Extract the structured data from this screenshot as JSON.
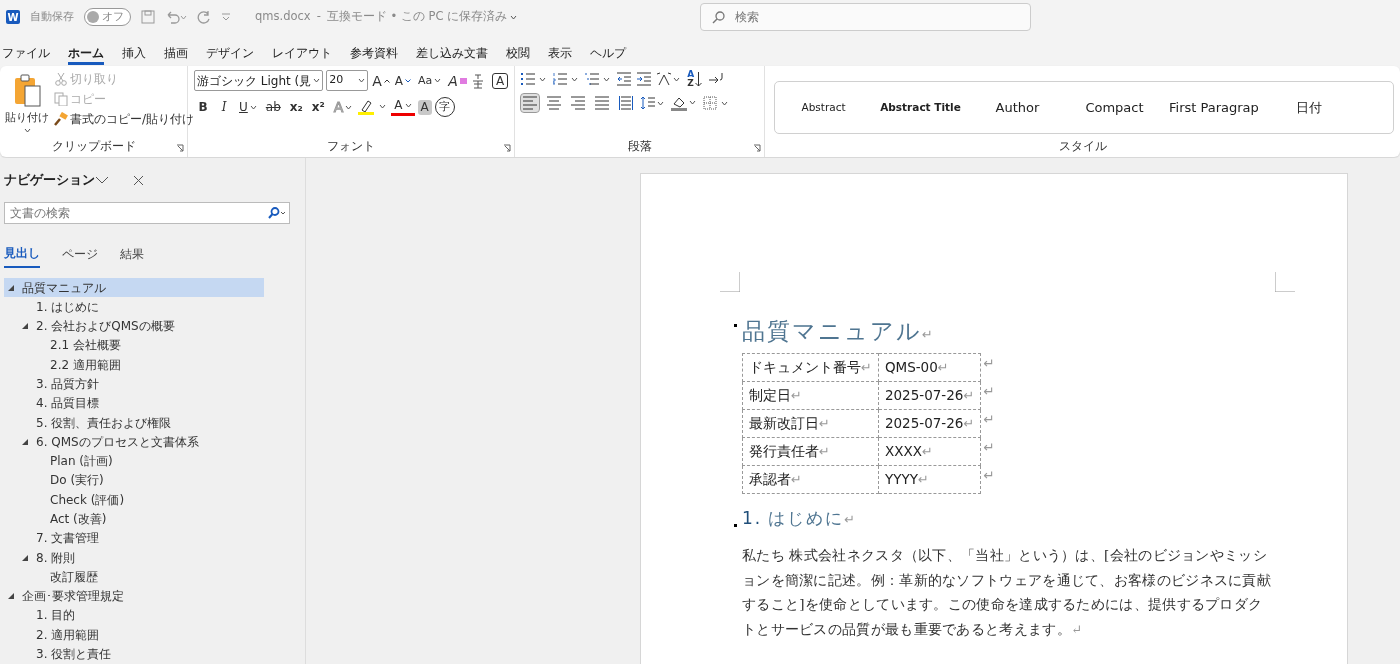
{
  "titlebar": {
    "app_logo": "W",
    "autosave_label": "自動保存",
    "autosave_toggle": {
      "label": "オフ",
      "on": false
    },
    "filename": "qms.docx",
    "separator": "-",
    "status": "互換モード • この PC に保存済み",
    "search_placeholder": "検索"
  },
  "menu_tabs": [
    {
      "label": "ファイル",
      "selected": false
    },
    {
      "label": "ホーム",
      "selected": true
    },
    {
      "label": "挿入",
      "selected": false
    },
    {
      "label": "描画",
      "selected": false
    },
    {
      "label": "デザイン",
      "selected": false
    },
    {
      "label": "レイアウト",
      "selected": false
    },
    {
      "label": "参考資料",
      "selected": false
    },
    {
      "label": "差し込み文書",
      "selected": false
    },
    {
      "label": "校閲",
      "selected": false
    },
    {
      "label": "表示",
      "selected": false
    },
    {
      "label": "ヘルプ",
      "selected": false
    }
  ],
  "ribbon": {
    "clipboard": {
      "paste": "貼り付け",
      "cut": {
        "label": "切り取り",
        "disabled": true
      },
      "copy": {
        "label": "コピー",
        "disabled": true
      },
      "format_painter": {
        "label": "書式のコピー/貼り付け",
        "disabled": false
      },
      "group_label": "クリップボード"
    },
    "font": {
      "font_name": "游ゴシック Light (見",
      "font_size": "20",
      "grow_font": "A",
      "shrink_font": "A",
      "change_case": "Aa",
      "clear_formatting": "A",
      "text_effects": "A",
      "font_color": "A",
      "bold": "B",
      "italic": "I",
      "underline": "U",
      "strikethrough": "ab",
      "subscript": "x₂",
      "superscript": "x²",
      "char_border": "A",
      "char_shading": "A",
      "enclosed": "字",
      "group_label": "フォント"
    },
    "paragraph": {
      "sort": {
        "top": "A",
        "bottom": "Z"
      },
      "alignment": [
        {
          "kind": "left",
          "selected": true
        },
        {
          "kind": "center",
          "selected": false
        },
        {
          "kind": "right",
          "selected": false
        },
        {
          "kind": "justify",
          "selected": false
        },
        {
          "kind": "distributed",
          "selected": false
        }
      ],
      "group_label": "段落"
    },
    "styles": {
      "items": [
        {
          "label": "Abstract",
          "kind": "small"
        },
        {
          "label": "Abstract Title",
          "kind": "bold"
        },
        {
          "label": "Author",
          "kind": "normal"
        },
        {
          "label": "Compact",
          "kind": "normal"
        },
        {
          "label": "First Paragrap",
          "kind": "normal"
        },
        {
          "label": "日付",
          "kind": "normal"
        }
      ],
      "group_label": "スタイル"
    }
  },
  "navigation": {
    "title": "ナビゲーション",
    "search_placeholder": "文書の検索",
    "tabs": [
      {
        "label": "見出し",
        "selected": true
      },
      {
        "label": "ページ",
        "selected": false
      },
      {
        "label": "結果",
        "selected": false
      }
    ],
    "tree": [
      {
        "label": "品質マニュアル",
        "selected": true,
        "expanded": true,
        "children": [
          {
            "label": "1. はじめに",
            "selected": false
          },
          {
            "label": "2. 会社およびQMSの概要",
            "selected": false,
            "expanded": true,
            "children": [
              {
                "label": "2.1 会社概要",
                "selected": false
              },
              {
                "label": "2.2 適用範囲",
                "selected": false
              }
            ]
          },
          {
            "label": "3. 品質方針",
            "selected": false
          },
          {
            "label": "4. 品質目標",
            "selected": false
          },
          {
            "label": "5. 役割、責任および権限",
            "selected": false
          },
          {
            "label": "6. QMSのプロセスと文書体系",
            "selected": false,
            "expanded": true,
            "children": [
              {
                "label": "Plan (計画)",
                "selected": false
              },
              {
                "label": "Do (実行)",
                "selected": false
              },
              {
                "label": "Check (評価)",
                "selected": false
              },
              {
                "label": "Act (改善)",
                "selected": false
              }
            ]
          },
          {
            "label": "7. 文書管理",
            "selected": false
          },
          {
            "label": "8. 附則",
            "selected": false,
            "expanded": true,
            "children": [
              {
                "label": "改訂履歴",
                "selected": false
              }
            ]
          }
        ]
      },
      {
        "label": "企画･要求管理規定",
        "selected": false,
        "expanded": true,
        "children": [
          {
            "label": "1. 目的",
            "selected": false
          },
          {
            "label": "2. 適用範囲",
            "selected": false
          },
          {
            "label": "3. 役割と責任",
            "selected": false
          }
        ]
      }
    ]
  },
  "document": {
    "title": {
      "text": "品質マニュアル",
      "mark": "↵"
    },
    "info_table": [
      {
        "cells": [
          {
            "text": "ドキュメント番号",
            "mark": "↵"
          },
          {
            "text": "QMS-00",
            "mark": "↵"
          }
        ],
        "end_mark": "↵"
      },
      {
        "cells": [
          {
            "text": "制定日",
            "mark": "↵"
          },
          {
            "text": "2025-07-26",
            "mark": "↵"
          }
        ],
        "end_mark": "↵"
      },
      {
        "cells": [
          {
            "text": "最新改訂日",
            "mark": "↵"
          },
          {
            "text": "2025-07-26",
            "mark": "↵"
          }
        ],
        "end_mark": "↵"
      },
      {
        "cells": [
          {
            "text": "発行責任者",
            "mark": "↵"
          },
          {
            "text": "XXXX",
            "mark": "↵"
          }
        ],
        "end_mark": "↵"
      },
      {
        "cells": [
          {
            "text": "承認者",
            "mark": "↵"
          },
          {
            "text": "YYYY",
            "mark": "↵"
          }
        ],
        "end_mark": "↵"
      }
    ],
    "heading": {
      "number": "1.",
      "text": "はじめに",
      "mark": "↵"
    },
    "paragraph": {
      "text": "私たち 株式会社ネクスタ（以下、「当社」という）は、[会社のビジョンやミッションを簡潔に記述。例：革新的なソフトウェアを通じて、お客様のビジネスに貢献すること]を使命としています。この使命を達成するためには、提供するプロダクトとサービスの品質が最も重要であると考えます。",
      "mark": "↵"
    }
  }
}
